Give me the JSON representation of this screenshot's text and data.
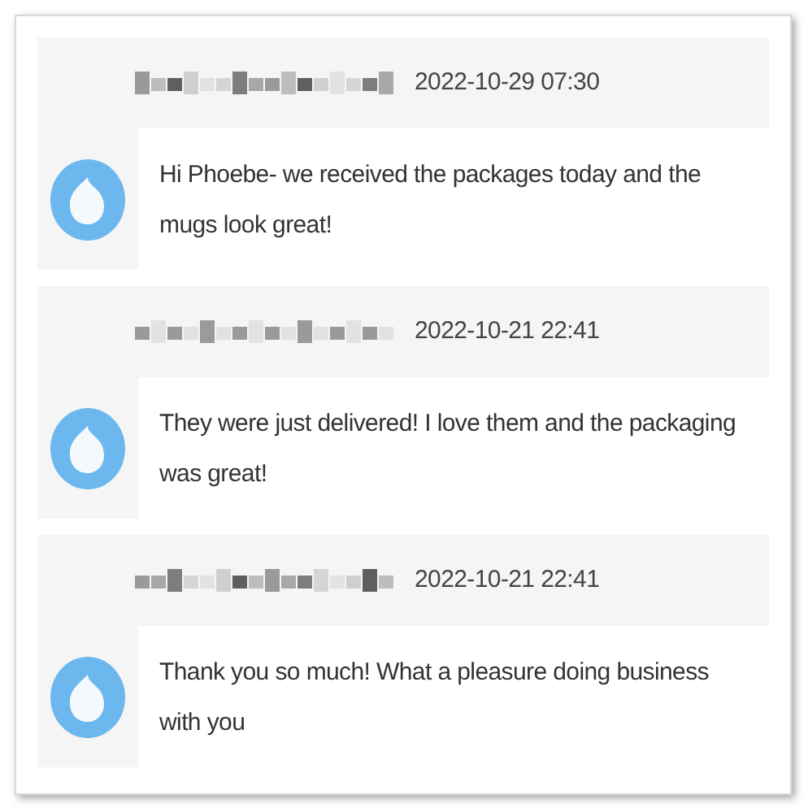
{
  "messages": [
    {
      "time": "2022-10-29 07:30",
      "text": "Hi Phoebe- we received the packages today and the mugs look great!"
    },
    {
      "time": "2022-10-21 22:41",
      "text": "They were just delivered! I love them and the packaging was great!"
    },
    {
      "time": "2022-10-21 22:41",
      "text": "Thank you so much! What a pleasure doing business with you"
    }
  ]
}
